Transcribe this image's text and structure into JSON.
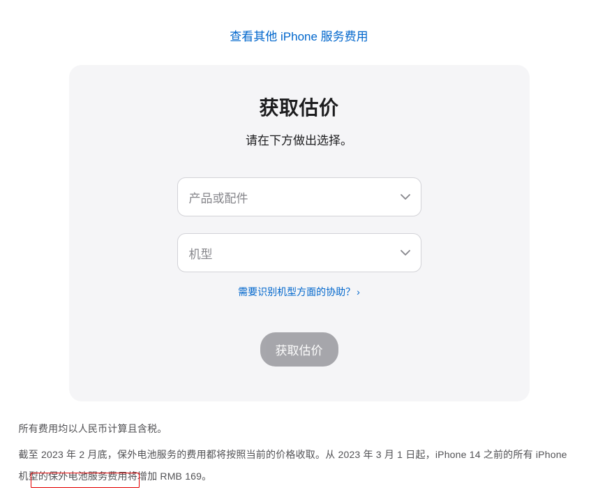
{
  "topLink": {
    "label": "查看其他 iPhone 服务费用"
  },
  "card": {
    "title": "获取估价",
    "subtitle": "请在下方做出选择。",
    "select1": {
      "placeholder": "产品或配件"
    },
    "select2": {
      "placeholder": "机型"
    },
    "helpLink": {
      "label": "需要识别机型方面的协助？",
      "arrow": "›"
    },
    "button": {
      "label": "获取估价"
    }
  },
  "footnotes": {
    "line1": "所有费用均以人民币计算且含税。",
    "line2": "截至 2023 年 2 月底，保外电池服务的费用都将按照当前的价格收取。从 2023 年 3 月 1 日起，iPhone 14 之前的所有 iPhone 机型的保外电池服务费用将增加 RMB 169。"
  }
}
